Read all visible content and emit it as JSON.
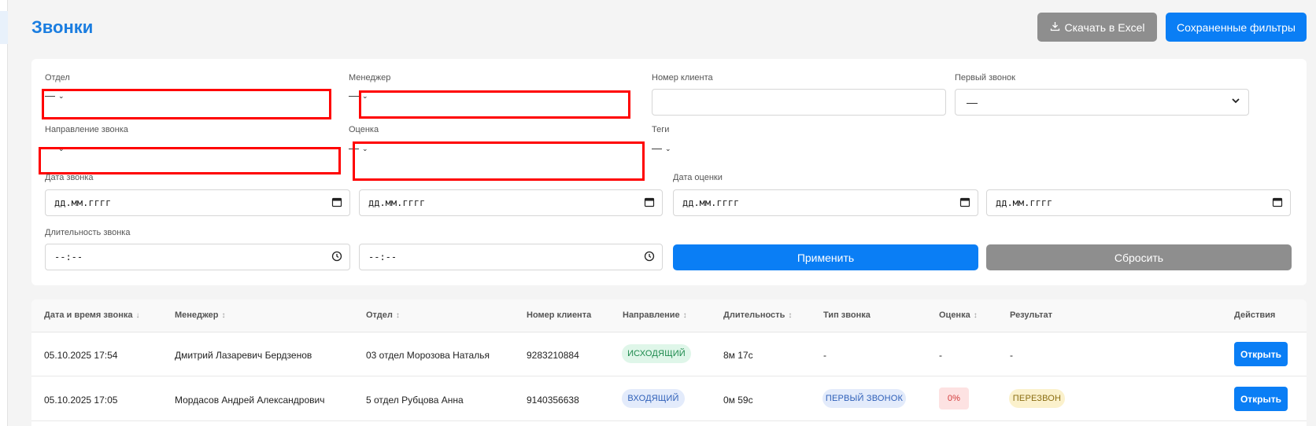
{
  "page": {
    "title": "Звонки"
  },
  "header": {
    "excel_label": "Скачать в Excel",
    "saved_filters_label": "Сохраненные фильтры"
  },
  "filters": {
    "department": {
      "label": "Отдел",
      "value": "—"
    },
    "manager": {
      "label": "Менеджер",
      "value": "—"
    },
    "client_number": {
      "label": "Номер клиента",
      "value": ""
    },
    "first_call": {
      "label": "Первый звонок",
      "value": "—"
    },
    "direction": {
      "label": "Направление звонка",
      "value": "—"
    },
    "rating": {
      "label": "Оценка",
      "value": "—"
    },
    "tags": {
      "label": "Теги",
      "value": "—"
    },
    "call_date": {
      "label": "Дата звонка",
      "from": "дд.мм.гггг",
      "to": "дд.мм.гггг"
    },
    "rating_date": {
      "label": "Дата оценки",
      "from": "дд.мм.гггг",
      "to": "дд.мм.гггг"
    },
    "duration": {
      "label": "Длительность звонка",
      "from": "--:--",
      "to": "--:--"
    },
    "apply_label": "Применить",
    "reset_label": "Сбросить"
  },
  "table": {
    "columns": [
      "Дата и время звонка",
      "Менеджер",
      "Отдел",
      "Номер клиента",
      "Направление",
      "Длительность",
      "Тип звонка",
      "Оценка",
      "Результат",
      "Действия"
    ],
    "rows": [
      {
        "datetime": "05.10.2025 17:54",
        "manager": "Дмитрий Лазаревич Бердзенов",
        "department": "03 отдел Морозова Наталья",
        "client": "9283210884",
        "direction": "исходящий",
        "duration": "8м 17с",
        "type": "-",
        "score": "-",
        "result": "-",
        "action": "Открыть"
      },
      {
        "datetime": "05.10.2025 17:05",
        "manager": "Мордасов Андрей Александрович",
        "department": "5 отдел Рубцова Анна",
        "client": "9140356638",
        "direction": "входящий",
        "duration": "0м 59с",
        "type": "первый звонок",
        "score": "0%",
        "result": "перезвон",
        "action": "Открыть"
      }
    ]
  },
  "colors": {
    "accent": "#0a7ef5",
    "title": "#1a7de0",
    "secondary_button": "#8e8e8e",
    "highlight": "#ff0000"
  }
}
